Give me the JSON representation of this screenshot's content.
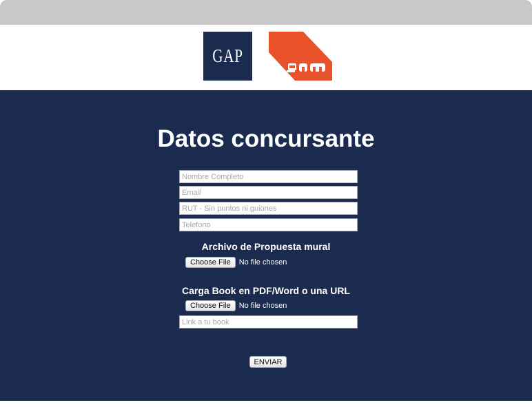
{
  "header": {
    "logos": [
      {
        "name": "gap",
        "text": "GAP",
        "color": "#1b2a4f"
      },
      {
        "name": "gam",
        "text": "gam",
        "color": "#e8512a"
      }
    ]
  },
  "form": {
    "title": "Datos concursante",
    "fields": {
      "name_placeholder": "Nombre Completo",
      "email_placeholder": "Email",
      "rut_placeholder": "RUT - Sin puntos ni guiones",
      "phone_placeholder": "Telefono",
      "book_link_placeholder": "Link a tu book"
    },
    "mural_upload": {
      "label": "Archivo de Propuesta mural",
      "button_label": "Choose File",
      "status": "No file chosen"
    },
    "book_upload": {
      "label": "Carga Book en PDF/Word o una URL",
      "button_label": "Choose File",
      "status": "No file chosen"
    },
    "submit_label": "ENVIAR"
  },
  "colors": {
    "background_navy": "#1b2a4f",
    "accent_orange": "#e8512a",
    "top_bar_gray": "#c9c7c8"
  }
}
